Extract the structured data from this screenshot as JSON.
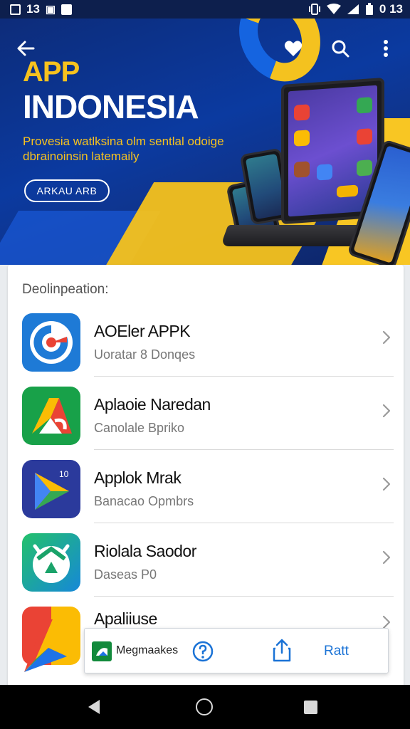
{
  "status_bar": {
    "left_label_1": "13",
    "right_time": "0 13"
  },
  "hero": {
    "title_line1": "APP",
    "title_line2": "INDONESIA",
    "subtitle": "Provesia watlksina olm sentlal odoige dbrainoinsin latemaily",
    "cta_label": "ARKAU ARB"
  },
  "list": {
    "section_title": "Deolinpeation:",
    "items": [
      {
        "name": "AOEler APPK",
        "subtitle": "Uoratar 8 Donqes"
      },
      {
        "name": "Aplaoie Naredan",
        "subtitle": "Canolale Bpriko"
      },
      {
        "name": "Applok Mrak",
        "subtitle": "Banacao Opmbrs"
      },
      {
        "name": "Riolala Saodor",
        "subtitle": "Daseas P0"
      },
      {
        "name": "Apaliiuse",
        "subtitle": ""
      }
    ]
  },
  "action_bar": {
    "label": "Megmaakes",
    "link": "Ratt"
  },
  "colors": {
    "accent_yellow": "#f7c21e",
    "banner_blue": "#0b3aa0",
    "link_blue": "#1b73d6",
    "green": "#128a3c"
  },
  "icons": [
    "back-arrow-icon",
    "heart-icon",
    "search-icon",
    "more-vert-icon",
    "chevron-right-icon",
    "help-icon",
    "share-icon",
    "nav-back-icon",
    "nav-home-icon",
    "nav-recents-icon"
  ]
}
